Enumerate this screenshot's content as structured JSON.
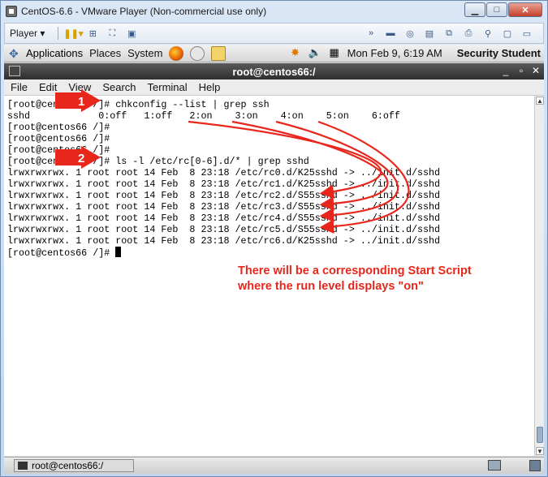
{
  "vmware": {
    "title": "CentOS-6.6 - VMware Player (Non-commercial use only)",
    "player_menu": "Player ▾"
  },
  "gnome_panel": {
    "applications": "Applications",
    "places": "Places",
    "system": "System",
    "clock": "Mon Feb  9,  6:19 AM",
    "user": "Security Student"
  },
  "terminal": {
    "title": "root@centos66:/",
    "menu": [
      "File",
      "Edit",
      "View",
      "Search",
      "Terminal",
      "Help"
    ],
    "lines": [
      "[root@centos66 /]# chkconfig --list | grep ssh",
      "sshd            0:off   1:off   2:on    3:on    4:on    5:on    6:off",
      "[root@centos66 /]#",
      "[root@centos66 /]#",
      "[root@centos66 /]#",
      "[root@centos66 /]# ls -l /etc/rc[0-6].d/* | grep sshd",
      "lrwxrwxrwx. 1 root root 14 Feb  8 23:18 /etc/rc0.d/K25sshd -> ../init.d/sshd",
      "lrwxrwxrwx. 1 root root 14 Feb  8 23:18 /etc/rc1.d/K25sshd -> ../init.d/sshd",
      "lrwxrwxrwx. 1 root root 14 Feb  8 23:18 /etc/rc2.d/S55sshd -> ../init.d/sshd",
      "lrwxrwxrwx. 1 root root 14 Feb  8 23:18 /etc/rc3.d/S55sshd -> ../init.d/sshd",
      "lrwxrwxrwx. 1 root root 14 Feb  8 23:18 /etc/rc4.d/S55sshd -> ../init.d/sshd",
      "lrwxrwxrwx. 1 root root 14 Feb  8 23:18 /etc/rc5.d/S55sshd -> ../init.d/sshd",
      "lrwxrwxrwx. 1 root root 14 Feb  8 23:18 /etc/rc6.d/K25sshd -> ../init.d/sshd",
      "[root@centos66 /]# "
    ]
  },
  "taskbar": {
    "item_label": "root@centos66:/"
  },
  "annotations": {
    "marker_1": "1",
    "marker_2": "2",
    "note_line1": "There will be a corresponding Start Script",
    "note_line2": "where the run level displays \"on\"",
    "accent_color": "#e8271c"
  }
}
